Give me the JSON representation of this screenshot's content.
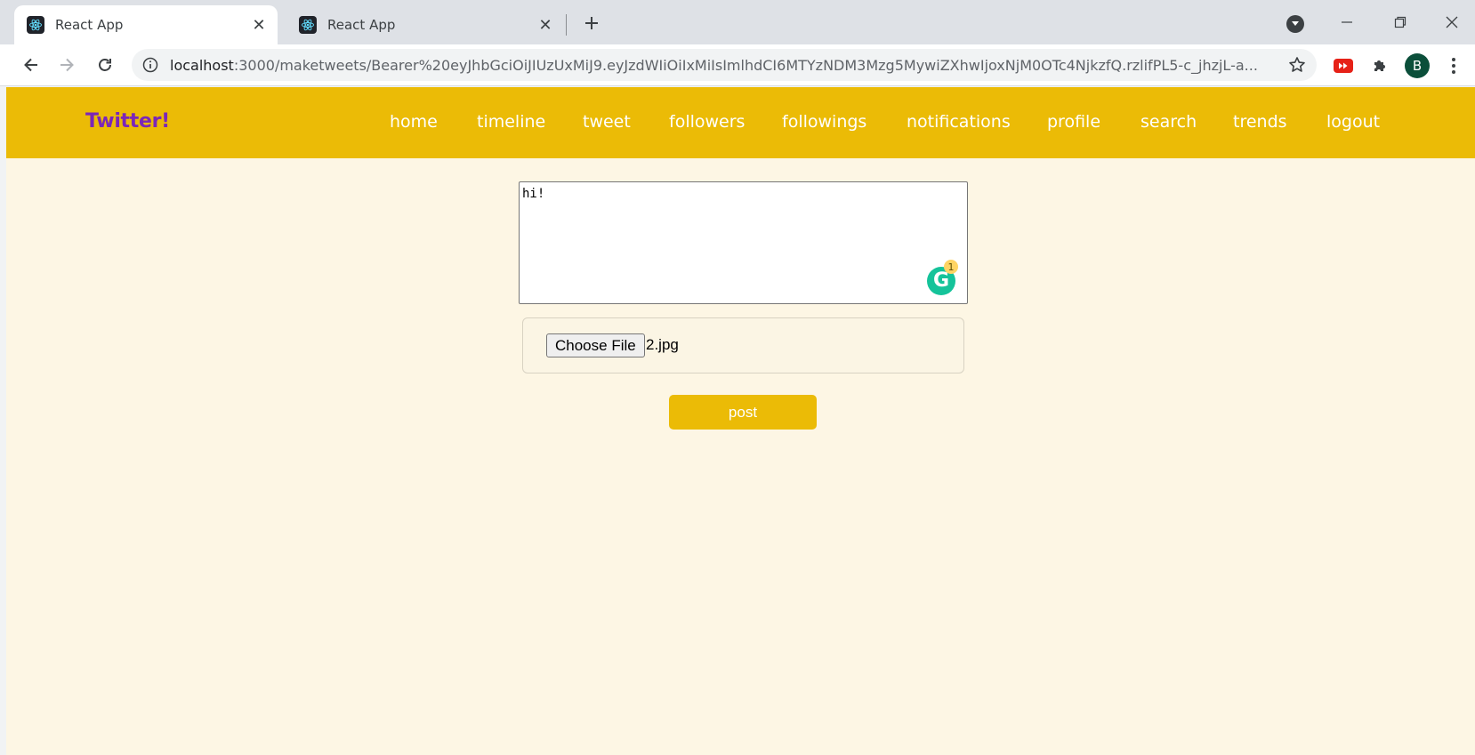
{
  "browser": {
    "tabs": [
      {
        "title": "React App",
        "active": true
      },
      {
        "title": "React App",
        "active": false
      }
    ],
    "url_host": "localhost",
    "url_rest": ":3000/maketweets/Bearer%20eyJhbGciOiJIUzUxMiJ9.eyJzdWIiOiIxMiIsImlhdCI6MTYzNDM3Mzg5MywiZXhwIjoxNjM0OTc4NjkzfQ.rzlifPL5-c_jhzjL-a...",
    "profile_initial": "B"
  },
  "app": {
    "brand": "Twitter!",
    "brand_color": "#7b26b8",
    "nav_color": "#ebbb06",
    "nav": [
      "home",
      "timeline",
      "tweet",
      "followers",
      "followings",
      "notifications",
      "profile",
      "search",
      "trends",
      "logout"
    ]
  },
  "composer": {
    "text": "hi!",
    "grammarly_count": "1"
  },
  "file_input": {
    "button_label": "Choose File",
    "file_name": "2.jpg"
  },
  "post_button": "post"
}
